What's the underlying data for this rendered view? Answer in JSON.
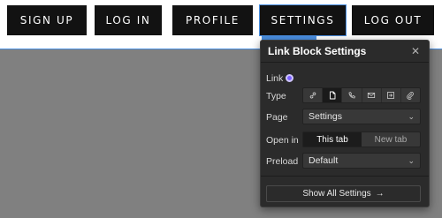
{
  "nav": {
    "items": [
      {
        "label": "SIGN UP"
      },
      {
        "label": "LOG IN"
      },
      {
        "label": "PROFILE"
      },
      {
        "label": "SETTINGS"
      },
      {
        "label": "LOG OUT"
      }
    ],
    "selected": "SETTINGS"
  },
  "selection_tag": {
    "icon": "link-block-icon"
  },
  "panel": {
    "title": "Link Block Settings",
    "close_icon": "close-icon",
    "link_label": "Link",
    "type_label": "Type",
    "type_options": [
      {
        "icon": "url-link-icon"
      },
      {
        "icon": "page-icon",
        "active": true
      },
      {
        "icon": "phone-icon"
      },
      {
        "icon": "email-icon"
      },
      {
        "icon": "section-icon"
      },
      {
        "icon": "file-attachment-icon"
      }
    ],
    "page_label": "Page",
    "page_value": "Settings",
    "open_in_label": "Open in",
    "open_in_options": [
      "This tab",
      "New tab"
    ],
    "open_in_selected": "This tab",
    "preload_label": "Preload",
    "preload_value": "Default",
    "show_all_label": "Show All Settings",
    "show_all_arrow": "→"
  },
  "colors": {
    "selection_blue": "#4a8fe0",
    "panel_bg": "#2b2b2b",
    "link_dot": "#7b61ff",
    "canvas_gray": "#808080",
    "nav_button_bg": "#121212"
  }
}
